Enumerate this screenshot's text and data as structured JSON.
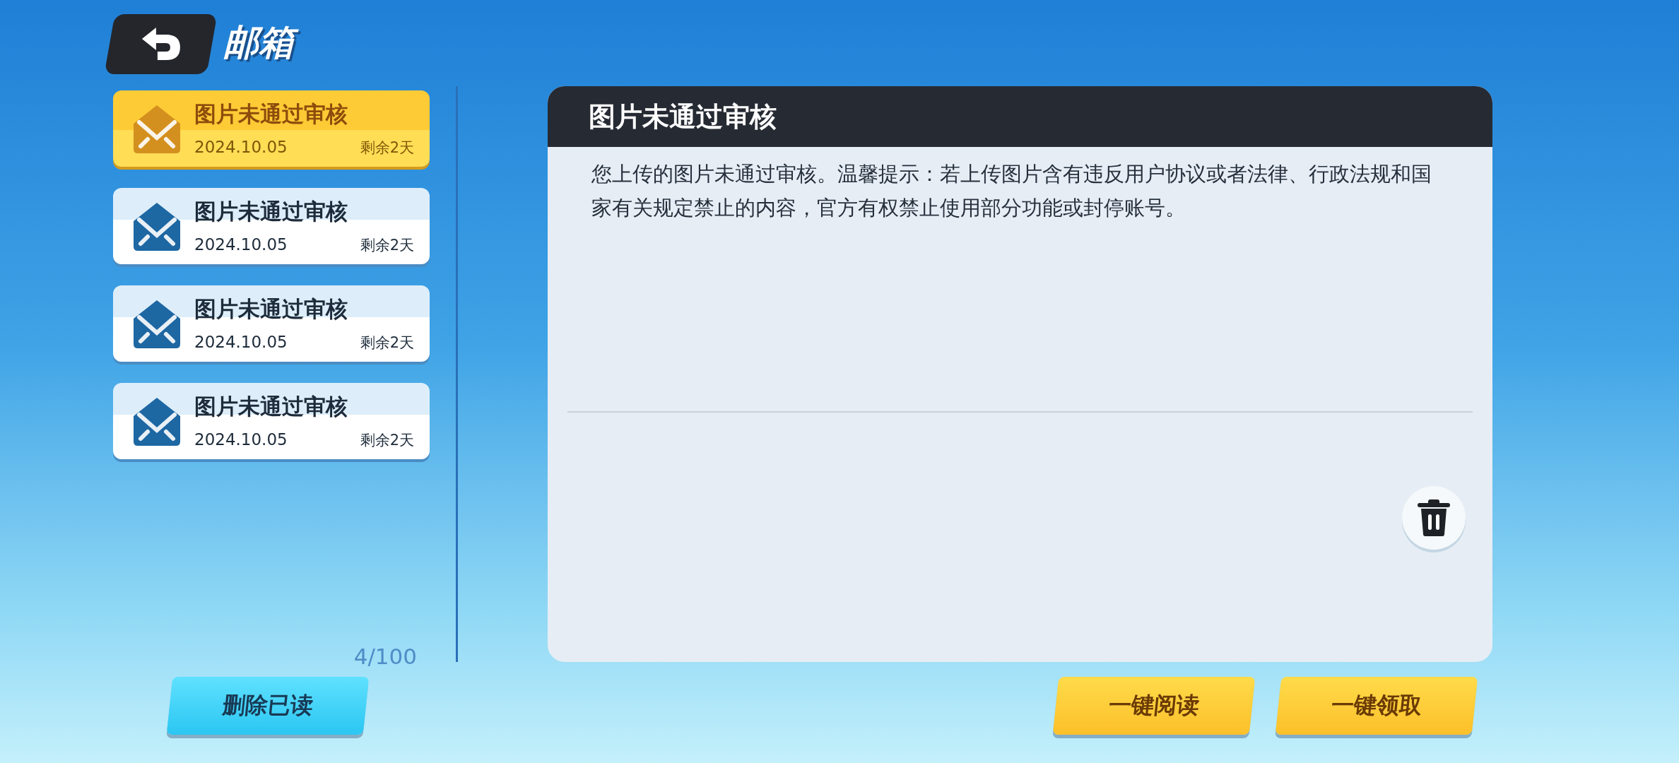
{
  "header": {
    "title": "邮箱"
  },
  "mails": [
    {
      "title": "图片未通过审核",
      "date": "2024.10.05",
      "remaining": "剩余2天",
      "selected": true
    },
    {
      "title": "图片未通过审核",
      "date": "2024.10.05",
      "remaining": "剩余2天",
      "selected": false
    },
    {
      "title": "图片未通过审核",
      "date": "2024.10.05",
      "remaining": "剩余2天",
      "selected": false
    },
    {
      "title": "图片未通过审核",
      "date": "2024.10.05",
      "remaining": "剩余2天",
      "selected": false
    }
  ],
  "mail_count": "4/100",
  "detail": {
    "title": "图片未通过审核",
    "body": "您上传的图片未通过审核。温馨提示：若上传图片含有违反用户协议或者法律、行政法规和国家有关规定禁止的内容，官方有权禁止使用部分功能或封停账号。"
  },
  "left_buttons": [
    {
      "label": "删除已读",
      "kind": "cyan"
    }
  ],
  "right_buttons": [
    {
      "label": "一键阅读",
      "kind": "yellow"
    },
    {
      "label": "一键领取",
      "kind": "yellow"
    }
  ]
}
